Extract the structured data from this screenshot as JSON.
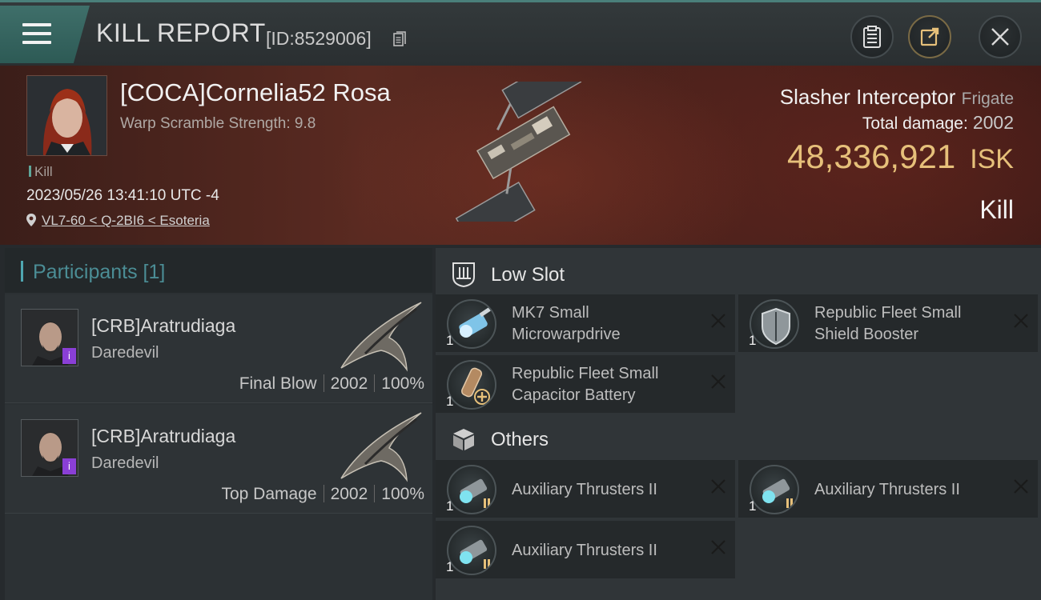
{
  "header": {
    "title": "KILL REPORT",
    "report_id": "[ID:8529006]"
  },
  "victim": {
    "name": "[COCA]Cornelia52 Rosa",
    "scramble": "Warp Scramble Strength: 9.8",
    "kill_tag": "Kill",
    "date": "2023/05/26 13:41:10 UTC -4",
    "location": "VL7-60 < Q-2BI6 < Esoteria"
  },
  "ship": {
    "name": "Slasher Interceptor",
    "class": "Frigate",
    "total_damage_label": "Total damage:",
    "total_damage": "2002",
    "isk_value": "48,336,921",
    "isk_unit": "ISK",
    "result": "Kill"
  },
  "participants": {
    "header": "Participants [1]",
    "items": [
      {
        "name": "[CRB]Aratrudiaga",
        "ship": "Daredevil",
        "role": "Final Blow",
        "damage": "2002",
        "percent": "100%"
      },
      {
        "name": "[CRB]Aratrudiaga",
        "ship": "Daredevil",
        "role": "Top Damage",
        "damage": "2002",
        "percent": "100%"
      }
    ]
  },
  "fitting": {
    "low_slot_label": "Low Slot",
    "others_label": "Others",
    "low_slot": [
      {
        "line1": "MK7 Small",
        "line2": "Microwarpdrive",
        "qty": "1"
      },
      {
        "line1": "Republic Fleet Small",
        "line2": "Shield Booster",
        "qty": "1"
      },
      {
        "line1": "Republic Fleet Small",
        "line2": "Capacitor Battery",
        "qty": "1"
      }
    ],
    "others": [
      {
        "name": "Auxiliary Thrusters II",
        "qty": "1"
      },
      {
        "name": "Auxiliary Thrusters II",
        "qty": "1"
      },
      {
        "name": "Auxiliary Thrusters II",
        "qty": "1"
      }
    ]
  },
  "colors": {
    "accent": "#4fa7b1",
    "isk": "#e6c07a",
    "tier_badge": "#8a3fd6"
  }
}
